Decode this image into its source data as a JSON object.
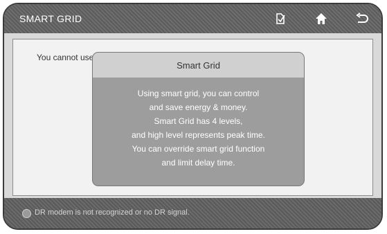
{
  "header": {
    "title": "SMART GRID",
    "icons": [
      "energy-tag-icon",
      "home-icon",
      "back-icon"
    ]
  },
  "main": {
    "message": "You cannot use... If you have questions about smart grid, please..."
  },
  "popup": {
    "title": "Smart Grid",
    "lines": [
      "Using smart grid, you can control",
      "and save energy & money.",
      "Smart Grid has 4 levels,",
      "and high level represents peak time.",
      "You can override smart grid function",
      "and limit delay time."
    ]
  },
  "footer": {
    "status": "DR modem is not recognized or no DR signal."
  }
}
